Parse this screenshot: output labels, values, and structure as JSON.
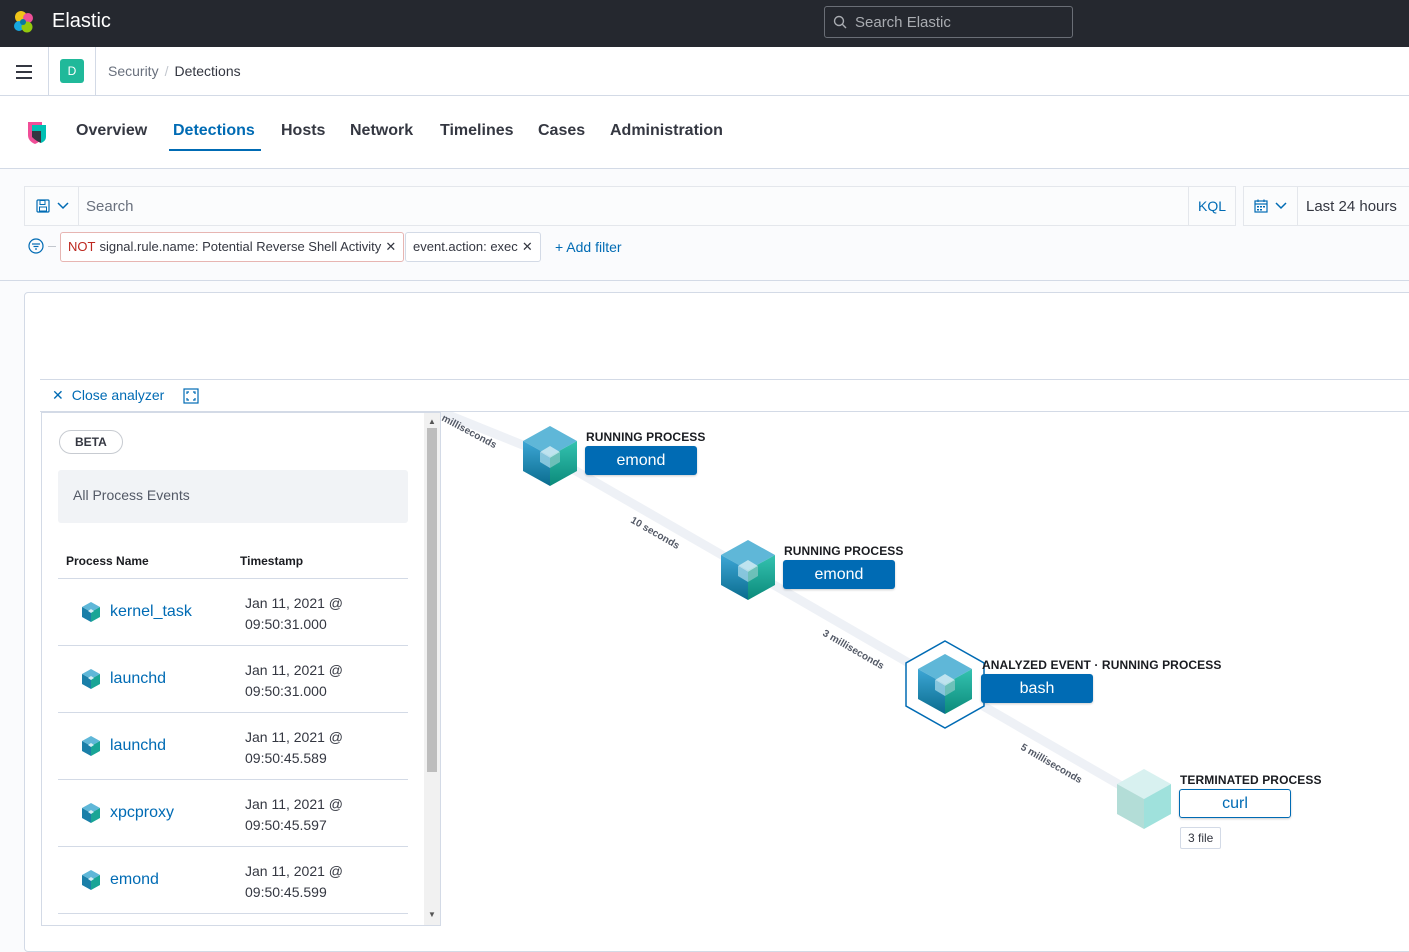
{
  "header": {
    "app_title": "Elastic",
    "search_placeholder": "Search Elastic"
  },
  "breadcrumb": {
    "space_initial": "D",
    "items": [
      "Security",
      "Detections"
    ]
  },
  "tabs": [
    {
      "label": "Overview",
      "active": false
    },
    {
      "label": "Detections",
      "active": true
    },
    {
      "label": "Hosts",
      "active": false
    },
    {
      "label": "Network",
      "active": false
    },
    {
      "label": "Timelines",
      "active": false
    },
    {
      "label": "Cases",
      "active": false
    },
    {
      "label": "Administration",
      "active": false
    }
  ],
  "query": {
    "placeholder": "Search",
    "language": "KQL",
    "time_range": "Last 24 hours"
  },
  "filters": [
    {
      "negated_label": "NOT",
      "text": "signal.rule.name: Potential Reverse Shell Activity"
    },
    {
      "text": "event.action: exec"
    }
  ],
  "add_filter_label": "+ Add filter",
  "analyzer": {
    "close_label": "Close analyzer",
    "beta_label": "BETA",
    "all_events_label": "All Process Events",
    "columns": [
      "Process Name",
      "Timestamp"
    ],
    "rows": [
      {
        "name": "kernel_task",
        "ts_line1": "Jan 11, 2021 @",
        "ts_line2": "09:50:31.000"
      },
      {
        "name": "launchd",
        "ts_line1": "Jan 11, 2021 @",
        "ts_line2": "09:50:31.000"
      },
      {
        "name": "launchd",
        "ts_line1": "Jan 11, 2021 @",
        "ts_line2": "09:50:45.589"
      },
      {
        "name": "xpcproxy",
        "ts_line1": "Jan 11, 2021 @",
        "ts_line2": "09:50:45.597"
      },
      {
        "name": "emond",
        "ts_line1": "Jan 11, 2021 @",
        "ts_line2": "09:50:45.599"
      }
    ]
  },
  "graph": {
    "edge_labels": [
      "milliseconds",
      "10 seconds",
      "3 milliseconds",
      "5 milliseconds"
    ],
    "nodes": [
      {
        "state": "RUNNING PROCESS",
        "name": "emond"
      },
      {
        "state": "RUNNING PROCESS",
        "name": "emond"
      },
      {
        "state": "ANALYZED EVENT · RUNNING PROCESS",
        "name": "bash"
      },
      {
        "state": "TERMINATED PROCESS",
        "name": "curl",
        "related": "3 file"
      }
    ]
  },
  "colors": {
    "accent": "#006bb4",
    "header_bg": "#25282f",
    "negated_filter": "#bd271e"
  }
}
